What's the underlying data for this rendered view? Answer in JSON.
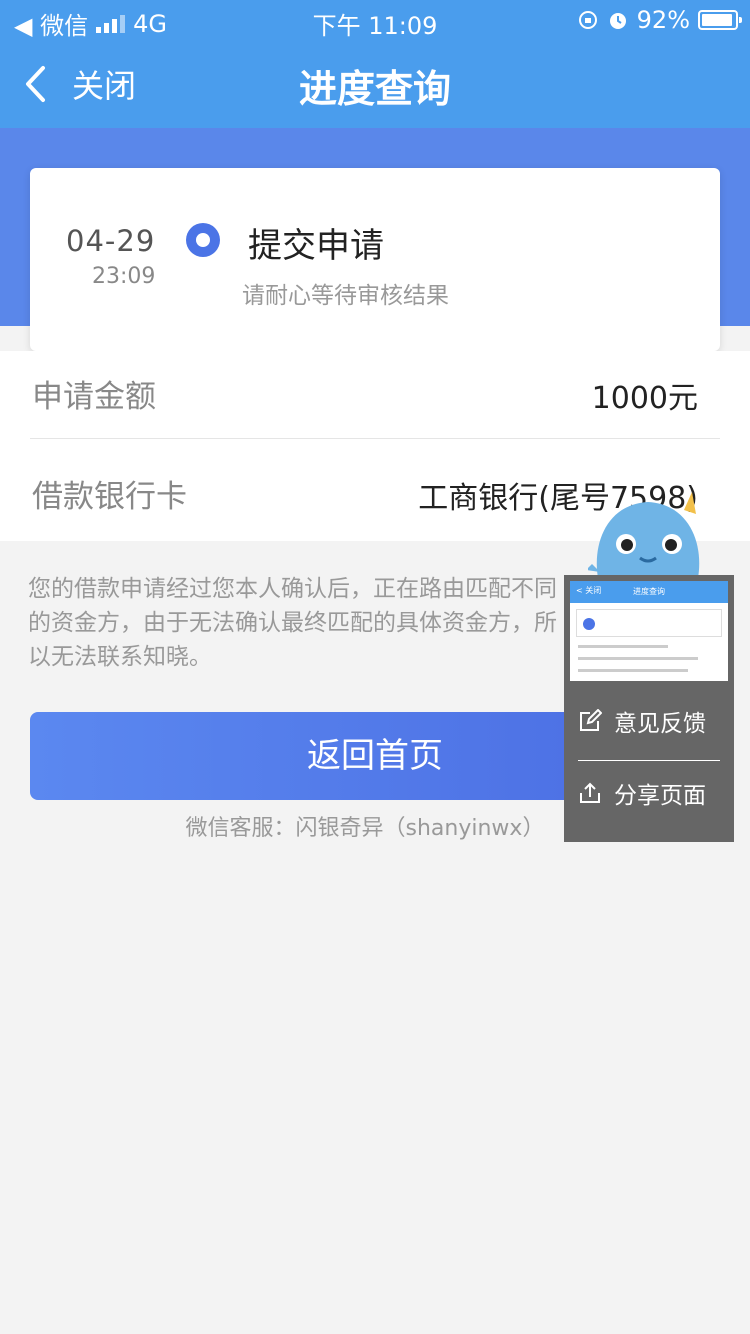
{
  "status_bar": {
    "carrier": "◀ 微信",
    "network": "4G",
    "time": "下午 11:09",
    "battery": "92%"
  },
  "nav": {
    "back_label": "关闭",
    "title": "进度查询"
  },
  "progress": {
    "date": "04-29",
    "time": "23:09",
    "step": "提交申请",
    "hint": "请耐心等待审核结果"
  },
  "info": {
    "amount_label": "申请金额",
    "amount_value": "1000元",
    "card_label": "借款银行卡",
    "card_value": "工商银行(尾号7598)"
  },
  "note": "您的借款申请经过您本人确认后，正在路由匹配不同的资金方，由于无法确认最终匹配的具体资金方，所以无法联系知晓。",
  "buttons": {
    "home": "返回首页"
  },
  "service": "微信客服：闪银奇异（shanyinwx）",
  "float_panel": {
    "thumb_title": "进度查询",
    "thumb_back": "< 关闭",
    "feedback": "意见反馈",
    "share": "分享页面"
  },
  "colors": {
    "nav_bg": "#4a9ded",
    "band_bg": "#5a87ea",
    "accent": "#4b74e6"
  }
}
